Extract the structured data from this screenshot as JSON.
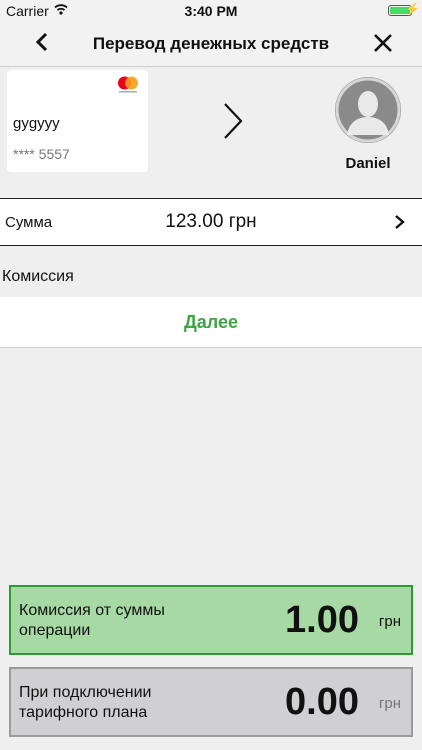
{
  "status_bar": {
    "carrier": "Carrier",
    "time": "3:40 PM",
    "wifi_icon": "wifi-icon",
    "battery_icon": "battery-icon",
    "battery_color": "#4cd964"
  },
  "navbar": {
    "title": "Перевод денежных средств",
    "back_icon": "chevron-left-icon",
    "close_icon": "close-icon"
  },
  "source_card": {
    "holder": "gygyyy",
    "number": "**** 5557",
    "brand_icon": "mastercard-logo-icon"
  },
  "transfer_arrow_icon": "chevron-right-icon",
  "recipient": {
    "name": "Daniel",
    "avatar_icon": "person-silhouette-icon"
  },
  "amount_row": {
    "label": "Сумма",
    "value": "123.00 грн",
    "chevron_icon": "chevron-right-icon"
  },
  "commission_label": "Комиссия",
  "next_button": {
    "label": "Далее",
    "color": "#3ea545"
  },
  "fee_boxes": [
    {
      "label": "Комиссия от суммы операции",
      "amount": "1.00",
      "currency": "грн",
      "background": "#a7d9a4",
      "border": "#2e9a36"
    },
    {
      "label": "При подключении тарифного плана",
      "amount": "0.00",
      "currency": "грн",
      "background": "#d0d0d3",
      "border": "#9b9b9b"
    }
  ]
}
